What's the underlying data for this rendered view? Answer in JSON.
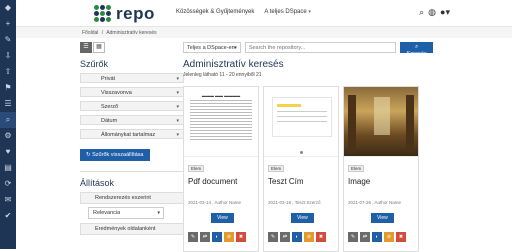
{
  "app": {
    "name": "repo"
  },
  "topnav": {
    "item1": "Közösségek & Gyűjtemények",
    "item2": "A teljes DSpace"
  },
  "breadcrumb": {
    "home": "Főoldal",
    "sep": "/",
    "current": "Adminisztratív keresés"
  },
  "sidebar": {
    "filters_title": "Szűrők",
    "facets": [
      "Privát",
      "Visszavonva",
      "Szerző",
      "Dátum",
      "Állománykat tartalmaz"
    ],
    "reset_button": "Szűrők visszaállítása",
    "settings_title": "Állítások",
    "sort_label": "Rendszerezés eszerint",
    "sort_value": "Relevancia",
    "results_per_page_label": "Eredmények oldalanként"
  },
  "search": {
    "scope": "Teljes a DSpace-en",
    "placeholder": "Search the repository...",
    "button": "Keresés"
  },
  "main": {
    "title": "Adminisztratív keresés",
    "result_info": "Jelenleg látható 11 - 20 ennyiből 21"
  },
  "cards": [
    {
      "badge": "Elem",
      "title": "Pdf document",
      "meta": "2021-03-14 , Author Name",
      "view": "View"
    },
    {
      "badge": "Elem",
      "title": "Teszt Cím",
      "meta": "2021-03-18 , Teszt Szerző",
      "view": "View"
    },
    {
      "badge": "Elem",
      "title": "Image",
      "meta": "2021-07-26 , Author Name",
      "view": "View"
    }
  ],
  "colors": {
    "primary": "#1f5fa8",
    "dark": "#1f3556"
  }
}
